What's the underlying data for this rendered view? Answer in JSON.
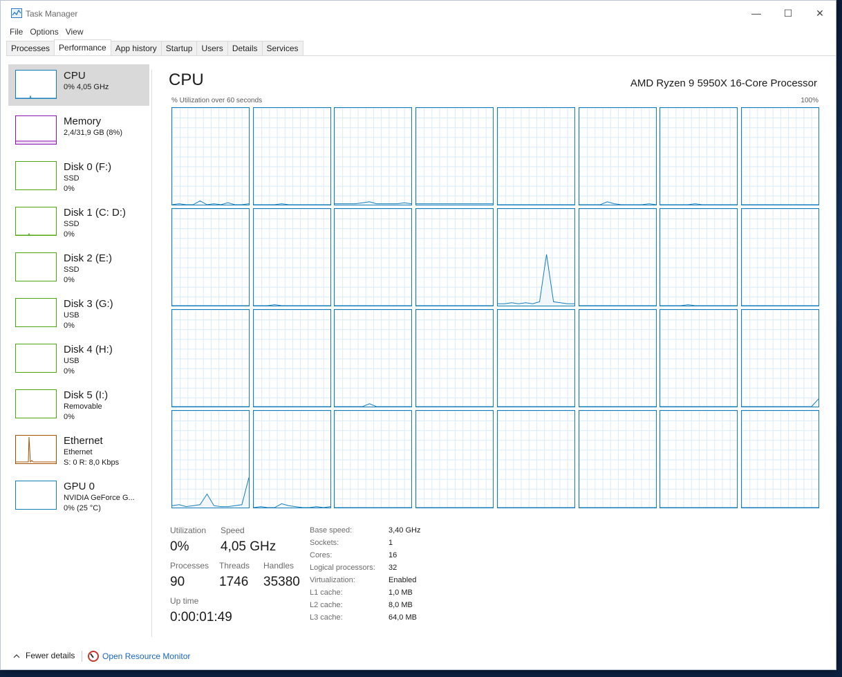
{
  "window": {
    "title": "Task Manager",
    "min_glyph": "—",
    "max_glyph": "☐",
    "close_glyph": "✕"
  },
  "menu": [
    "File",
    "Options",
    "View"
  ],
  "tabs": [
    "Processes",
    "Performance",
    "App history",
    "Startup",
    "Users",
    "Details",
    "Services"
  ],
  "active_tab": "Performance",
  "sidebar": [
    {
      "name": "CPU",
      "line1": "0% 4,05 GHz",
      "line2": "",
      "color": "#117dbb"
    },
    {
      "name": "Memory",
      "line1": "2,4/31,9 GB (8%)",
      "line2": "",
      "color": "#8b12ae"
    },
    {
      "name": "Disk 0 (F:)",
      "line1": "SSD",
      "line2": "0%",
      "color": "#4da60c"
    },
    {
      "name": "Disk 1 (C: D:)",
      "line1": "SSD",
      "line2": "0%",
      "color": "#4da60c"
    },
    {
      "name": "Disk 2 (E:)",
      "line1": "SSD",
      "line2": "0%",
      "color": "#4da60c"
    },
    {
      "name": "Disk 3 (G:)",
      "line1": "USB",
      "line2": "0%",
      "color": "#4da60c"
    },
    {
      "name": "Disk 4 (H:)",
      "line1": "USB",
      "line2": "0%",
      "color": "#4da60c"
    },
    {
      "name": "Disk 5 (I:)",
      "line1": "Removable",
      "line2": "0%",
      "color": "#4da60c"
    },
    {
      "name": "Ethernet",
      "line1": "Ethernet",
      "line2": "S: 0 R: 8,0 Kbps",
      "color": "#a74f01"
    },
    {
      "name": "GPU 0",
      "line1": "NVIDIA GeForce G...",
      "line2": "0% (25 °C)",
      "color": "#117dbb"
    }
  ],
  "main": {
    "title": "CPU",
    "model": "AMD Ryzen 9 5950X 16-Core Processor",
    "axis_label": "% Utilization over 60 seconds",
    "axis_max": "100%"
  },
  "stats": {
    "utilization_label": "Utilization",
    "utilization": "0%",
    "speed_label": "Speed",
    "speed": "4,05 GHz",
    "processes_label": "Processes",
    "processes": "90",
    "threads_label": "Threads",
    "threads": "1746",
    "handles_label": "Handles",
    "handles": "35380",
    "uptime_label": "Up time",
    "uptime": "0:00:01:49"
  },
  "specs": [
    {
      "label": "Base speed:",
      "value": "3,40 GHz"
    },
    {
      "label": "Sockets:",
      "value": "1"
    },
    {
      "label": "Cores:",
      "value": "16"
    },
    {
      "label": "Logical processors:",
      "value": "32"
    },
    {
      "label": "Virtualization:",
      "value": "Enabled"
    },
    {
      "label": "L1 cache:",
      "value": "1,0 MB"
    },
    {
      "label": "L2 cache:",
      "value": "8,0 MB"
    },
    {
      "label": "L3 cache:",
      "value": "64,0 MB"
    }
  ],
  "footer": {
    "fewer_details": "Fewer details",
    "open_resource_monitor": "Open Resource Monitor"
  },
  "chart_data": {
    "type": "line",
    "title": "% Utilization over 60 seconds",
    "ylim": [
      0,
      100
    ],
    "logical_processor_count": 32,
    "series_color": "#117dbb",
    "series": [
      {
        "values": [
          0,
          1,
          0,
          0,
          4,
          0,
          1,
          0,
          2,
          0,
          0,
          1
        ]
      },
      {
        "values": [
          0,
          0,
          0,
          0,
          1,
          0,
          0,
          0,
          0,
          0,
          0,
          0
        ]
      },
      {
        "values": [
          1,
          1,
          1,
          1,
          2,
          3,
          1,
          1,
          1,
          1,
          2,
          1
        ]
      },
      {
        "values": [
          1,
          1,
          1,
          1,
          1,
          1,
          1,
          1,
          1,
          1,
          1,
          1
        ]
      },
      {
        "values": [
          0,
          0,
          0,
          0,
          0,
          0,
          0,
          0,
          0,
          0,
          0,
          0
        ]
      },
      {
        "values": [
          0,
          0,
          0,
          0,
          3,
          1,
          0,
          0,
          0,
          0,
          1,
          0
        ]
      },
      {
        "values": [
          0,
          0,
          0,
          0,
          0,
          1,
          0,
          0,
          0,
          0,
          0,
          0
        ]
      },
      {
        "values": [
          0,
          0,
          0,
          0,
          0,
          0,
          0,
          0,
          0,
          0,
          0,
          0
        ]
      },
      {
        "values": [
          0,
          0,
          0,
          0,
          0,
          0,
          0,
          0,
          0,
          0,
          0,
          0
        ]
      },
      {
        "values": [
          0,
          0,
          0,
          1,
          0,
          0,
          0,
          0,
          0,
          0,
          0,
          0
        ]
      },
      {
        "values": [
          0,
          0,
          0,
          0,
          0,
          0,
          0,
          0,
          0,
          0,
          0,
          0
        ]
      },
      {
        "values": [
          0,
          0,
          0,
          0,
          0,
          0,
          0,
          0,
          0,
          0,
          0,
          0
        ]
      },
      {
        "values": [
          2,
          2,
          3,
          2,
          3,
          2,
          4,
          53,
          4,
          3,
          2,
          2
        ]
      },
      {
        "values": [
          0,
          0,
          0,
          0,
          0,
          0,
          0,
          0,
          0,
          0,
          0,
          0
        ]
      },
      {
        "values": [
          0,
          0,
          0,
          0,
          1,
          0,
          0,
          0,
          0,
          0,
          0,
          0
        ]
      },
      {
        "values": [
          0,
          0,
          0,
          0,
          0,
          0,
          0,
          0,
          0,
          0,
          0,
          0
        ]
      },
      {
        "values": [
          0,
          0,
          0,
          0,
          0,
          0,
          0,
          0,
          0,
          0,
          0,
          0
        ]
      },
      {
        "values": [
          0,
          0,
          0,
          0,
          0,
          0,
          0,
          0,
          0,
          0,
          0,
          0
        ]
      },
      {
        "values": [
          0,
          0,
          0,
          0,
          0,
          3,
          0,
          0,
          0,
          0,
          0,
          0
        ]
      },
      {
        "values": [
          0,
          0,
          0,
          0,
          0,
          0,
          0,
          0,
          0,
          0,
          0,
          0
        ]
      },
      {
        "values": [
          0,
          0,
          0,
          0,
          0,
          0,
          0,
          0,
          0,
          0,
          0,
          0
        ]
      },
      {
        "values": [
          0,
          0,
          0,
          0,
          0,
          0,
          0,
          0,
          0,
          0,
          0,
          0
        ]
      },
      {
        "values": [
          0,
          0,
          0,
          0,
          0,
          0,
          0,
          0,
          0,
          0,
          0,
          0
        ]
      },
      {
        "values": [
          0,
          0,
          0,
          0,
          0,
          0,
          0,
          0,
          0,
          0,
          0,
          8
        ]
      },
      {
        "values": [
          2,
          3,
          1,
          2,
          3,
          14,
          2,
          1,
          1,
          2,
          3,
          31
        ]
      },
      {
        "values": [
          0,
          1,
          0,
          0,
          4,
          2,
          1,
          0,
          0,
          1,
          0,
          1
        ]
      },
      {
        "values": [
          0,
          0,
          0,
          0,
          0,
          0,
          0,
          0,
          0,
          0,
          0,
          0
        ]
      },
      {
        "values": [
          0,
          0,
          0,
          0,
          0,
          0,
          0,
          0,
          0,
          0,
          0,
          0
        ]
      },
      {
        "values": [
          0,
          0,
          0,
          0,
          0,
          0,
          0,
          0,
          0,
          0,
          0,
          0
        ]
      },
      {
        "values": [
          0,
          0,
          0,
          0,
          0,
          0,
          0,
          0,
          0,
          0,
          0,
          0
        ]
      },
      {
        "values": [
          0,
          0,
          0,
          0,
          0,
          0,
          0,
          0,
          0,
          0,
          0,
          0
        ]
      },
      {
        "values": [
          0,
          0,
          0,
          0,
          0,
          0,
          0,
          0,
          0,
          0,
          0,
          0
        ]
      }
    ]
  }
}
